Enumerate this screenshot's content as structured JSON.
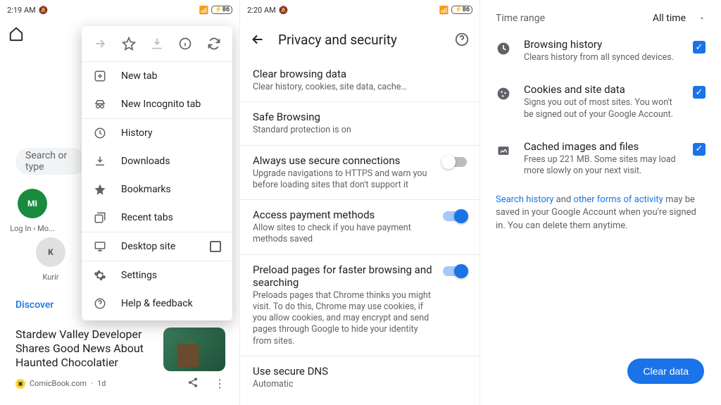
{
  "panel1": {
    "time": "2:19 AM",
    "battery": "86",
    "search_placeholder": "Search or type",
    "sites": [
      {
        "label": "Log In ‹ Mo...",
        "initials": "MI",
        "bg": "#1a8a3e"
      },
      {
        "label": "Kurir",
        "initials": "K",
        "bg": "#9e9e9e"
      }
    ],
    "discover": "Discover",
    "article": {
      "title": "Stardew Valley Developer Shares Good News About Haunted Chocolatier",
      "source": "ComicBook.com",
      "age": "1d"
    },
    "menu": {
      "items": [
        "New tab",
        "New Incognito tab",
        "History",
        "Downloads",
        "Bookmarks",
        "Recent tabs",
        "Desktop site",
        "Settings",
        "Help & feedback"
      ]
    }
  },
  "panel2": {
    "time": "2:20 AM",
    "battery": "86",
    "title": "Privacy and security",
    "rows": [
      {
        "title": "Clear browsing data",
        "sub": "Clear history, cookies, site data, cache…"
      },
      {
        "title": "Safe Browsing",
        "sub": "Standard protection is on"
      },
      {
        "title": "Always use secure connections",
        "sub": "Upgrade navigations to HTTPS and warn you before loading sites that don't support it",
        "toggle": "off"
      },
      {
        "title": "Access payment methods",
        "sub": "Allow sites to check if you have payment methods saved",
        "toggle": "on"
      },
      {
        "title": "Preload pages for faster browsing and searching",
        "sub": "Preloads pages that Chrome thinks you might visit. To do this, Chrome may use cookies, if you allow cookies, and may encrypt and send pages through Google to hide your identity from sites.",
        "toggle": "on"
      },
      {
        "title": "Use secure DNS",
        "sub": "Automatic"
      }
    ]
  },
  "panel3": {
    "time_range_label": "Time range",
    "time_range_value": "All time",
    "items": [
      {
        "title": "Browsing history",
        "sub": "Clears history from all synced devices."
      },
      {
        "title": "Cookies and site data",
        "sub": "Signs you out of most sites. You won't be signed out of your Google Account."
      },
      {
        "title": "Cached images and files",
        "sub": "Frees up 221 MB. Some sites may load more slowly on your next visit."
      }
    ],
    "info_before": "Search history",
    "info_mid1": " and ",
    "info_link2": "other forms of activity",
    "info_after": " may be saved in your Google Account when you're signed in. You can delete them anytime.",
    "clear_button": "Clear data"
  }
}
